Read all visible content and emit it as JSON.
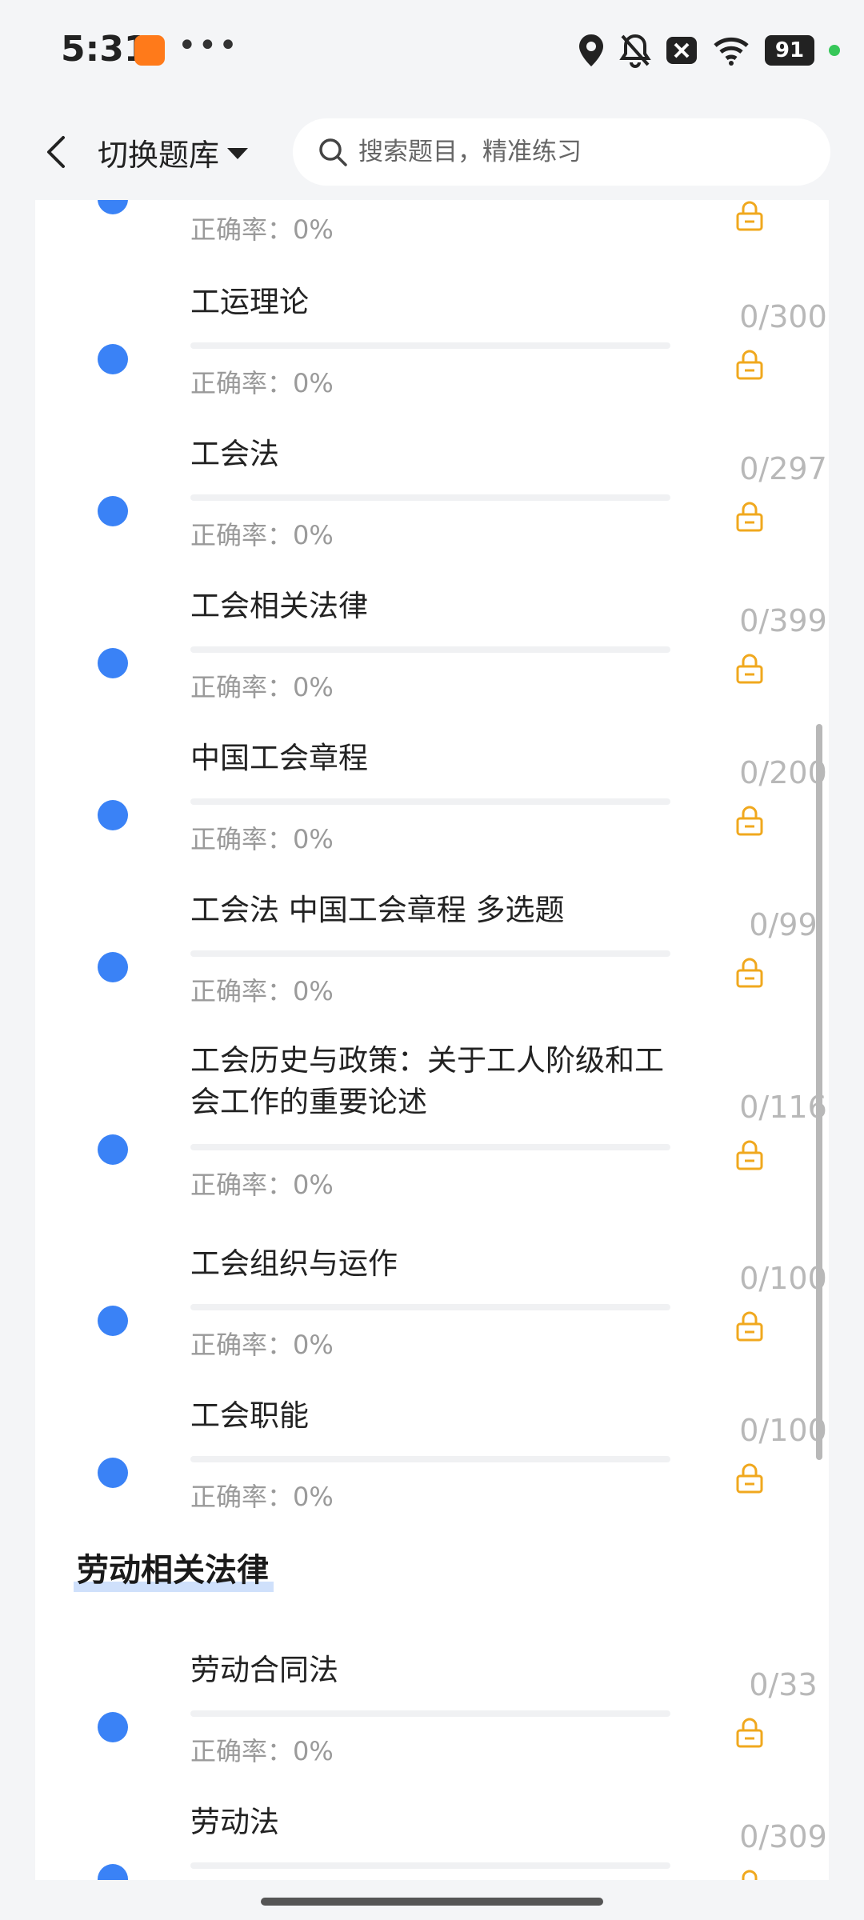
{
  "status_bar": {
    "time": "5:31",
    "battery": "91",
    "icons": [
      "location-icon",
      "mute-bell-icon",
      "close-box-icon",
      "wifi-icon",
      "battery-icon"
    ]
  },
  "header": {
    "title": "切换题库",
    "search_placeholder": "搜索题目，精准练习"
  },
  "accuracy_label": "正确率：0%",
  "items": [
    {
      "title": "",
      "count": ""
    },
    {
      "title": "工运理论",
      "count": "0/300"
    },
    {
      "title": "工会法",
      "count": "0/297"
    },
    {
      "title": "工会相关法律",
      "count": "0/399"
    },
    {
      "title": "中国工会章程",
      "count": "0/200"
    },
    {
      "title": "工会法 中国工会章程 多选题",
      "count": "0/99"
    },
    {
      "title": "工会历史与政策：关于工人阶级和工会工作的重要论述",
      "count": "0/116"
    },
    {
      "title": "工会组织与运作",
      "count": "0/100"
    },
    {
      "title": "工会职能",
      "count": "0/100"
    }
  ],
  "section": {
    "title": "劳动相关法律"
  },
  "section_items": [
    {
      "title": "劳动合同法",
      "count": "0/33"
    },
    {
      "title": "劳动法",
      "count": "0/309"
    }
  ],
  "colors": {
    "accent": "#3a82f6",
    "lock": "#f0a81e",
    "muted": "#b8b8b8"
  }
}
